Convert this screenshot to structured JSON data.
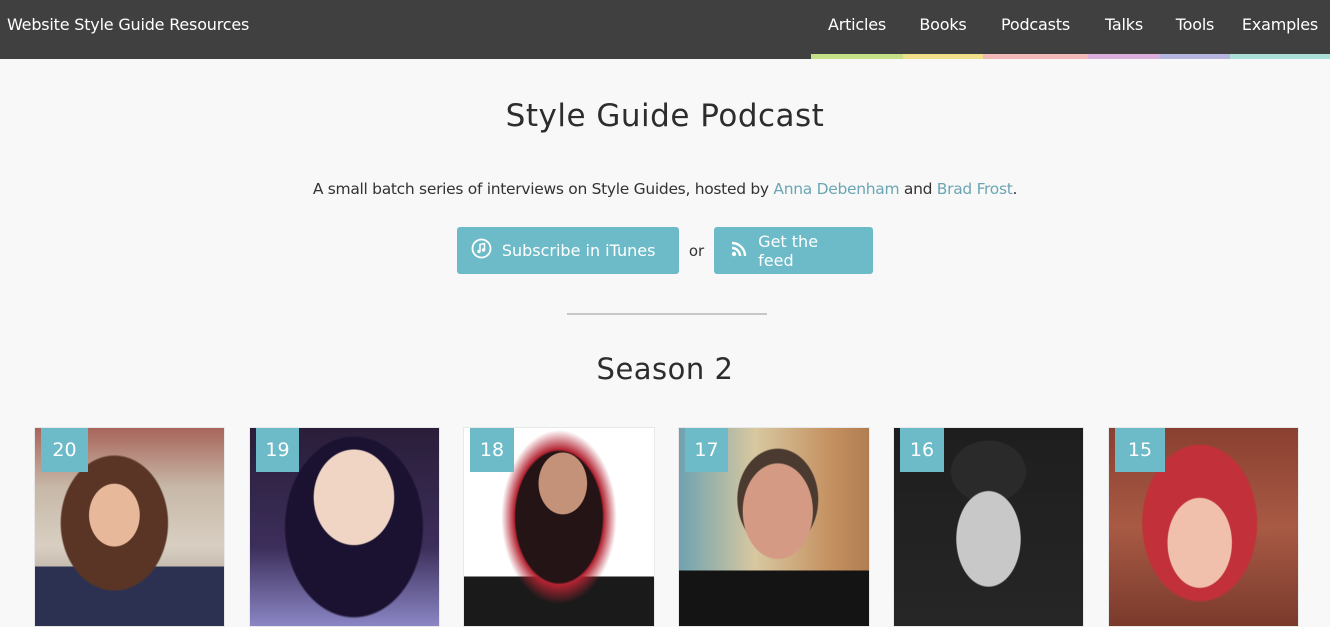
{
  "header": {
    "brand": "Website Style Guide Resources",
    "nav": [
      {
        "label": "Articles",
        "color": "#c6e08a"
      },
      {
        "label": "Books",
        "color": "#f0e08a"
      },
      {
        "label": "Podcasts",
        "color": "#f2b9b9"
      },
      {
        "label": "Talks",
        "color": "#dcaedc"
      },
      {
        "label": "Tools",
        "color": "#b5b5e0"
      },
      {
        "label": "Examples",
        "color": "#a9dfd4"
      }
    ]
  },
  "main": {
    "title": "Style Guide Podcast",
    "intro": {
      "prefix": "A small batch series of interviews on Style Guides, hosted by ",
      "host1": "Anna Debenham",
      "middle": " and ",
      "host2": "Brad Frost",
      "suffix": "."
    },
    "cta": {
      "itunes_label": "Subscribe in iTunes",
      "itunes_icon": "music-note-icon",
      "or_label": "or",
      "feed_label": "Get the feed",
      "feed_icon": "rss-icon"
    },
    "season_title": "Season 2",
    "episodes": [
      {
        "number": "20"
      },
      {
        "number": "19"
      },
      {
        "number": "18"
      },
      {
        "number": "17"
      },
      {
        "number": "16"
      },
      {
        "number": "15"
      }
    ]
  },
  "colors": {
    "accent": "#6dbbc8",
    "link": "#6aa6b3",
    "topbar": "#404040"
  }
}
